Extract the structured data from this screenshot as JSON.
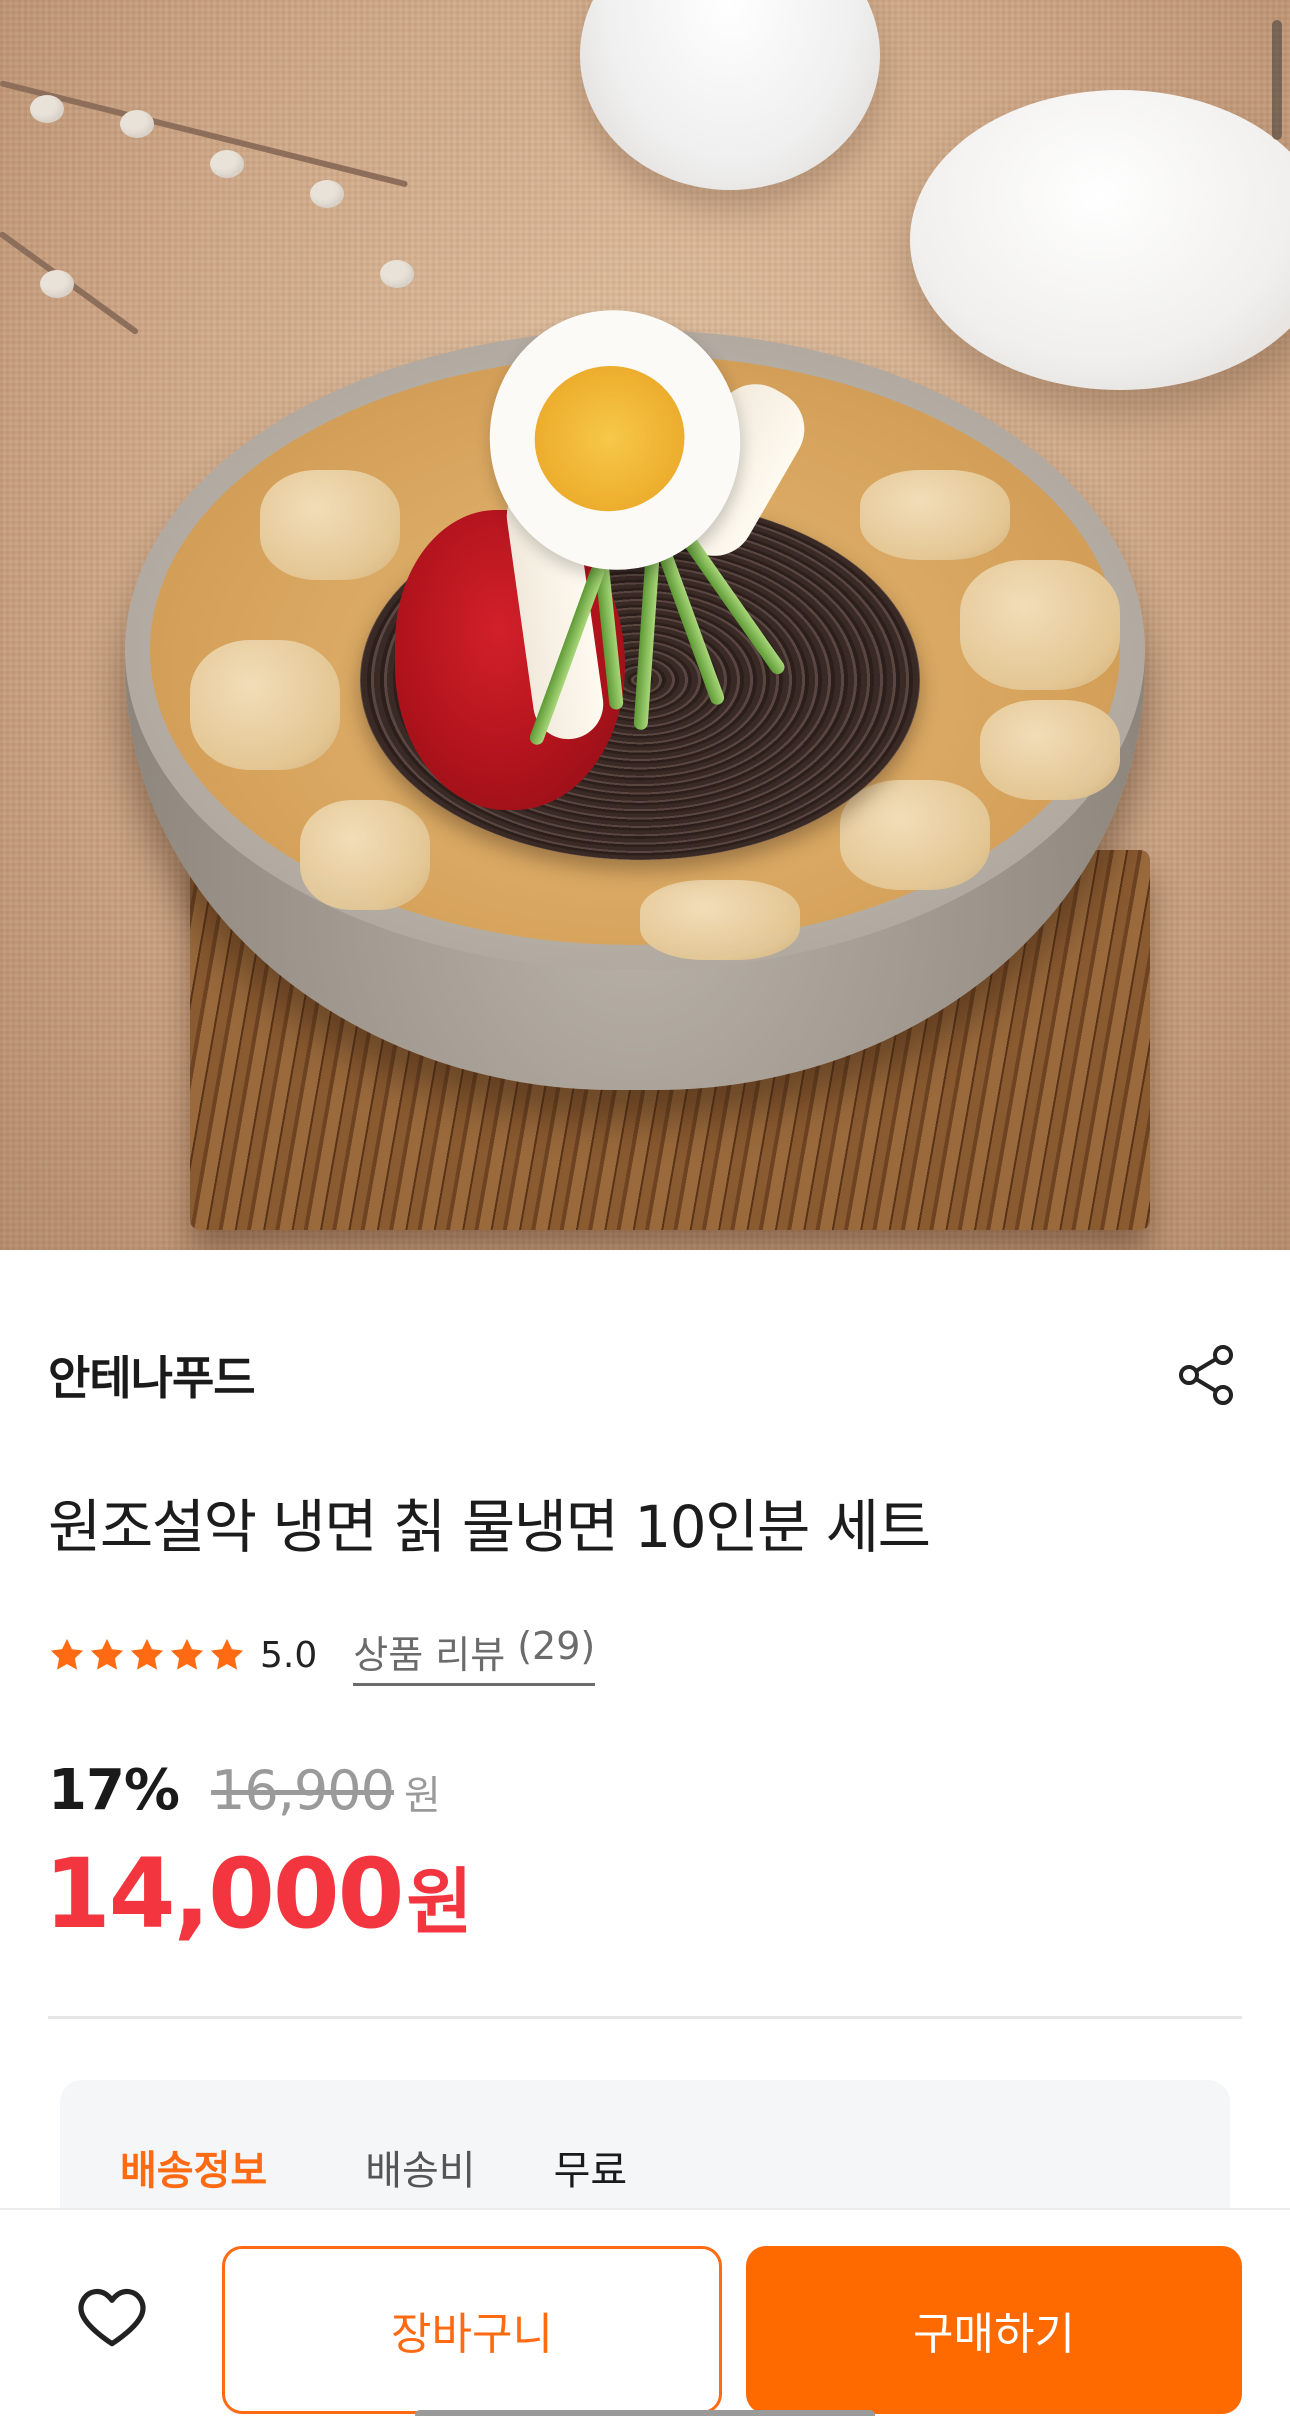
{
  "product": {
    "brand": "안테나푸드",
    "title": "원조설악 냉면 칡 물냉면 10인분 세트",
    "rating": "5.0",
    "review_label": "상품 리뷰",
    "review_count": "(29)",
    "discount_rate": "17%",
    "original_price": "16,900",
    "original_price_unit": "원",
    "price": "14,000",
    "price_unit": "원"
  },
  "shipping": {
    "label": "배송정보",
    "fee_key": "배송비",
    "fee_value": "무료"
  },
  "action_bar": {
    "cart_label": "장바구니",
    "buy_label": "구매하기"
  },
  "icons": {
    "share": "share-icon",
    "star": "star-icon",
    "wishlist": "heart-icon"
  },
  "colors": {
    "accent": "#ff6a00",
    "price": "#f2353f",
    "star": "#ff6a13"
  }
}
